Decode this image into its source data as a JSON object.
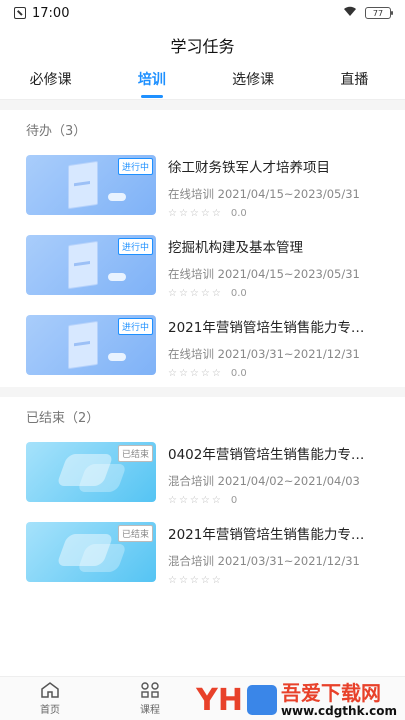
{
  "status": {
    "time": "17:00",
    "battery": "77"
  },
  "header": {
    "title": "学习任务"
  },
  "tabs": [
    {
      "label": "必修课"
    },
    {
      "label": "培训"
    },
    {
      "label": "选修课"
    },
    {
      "label": "直播"
    }
  ],
  "sections": [
    {
      "title": "待办（3）",
      "items": [
        {
          "name": "徐工财务铁军人才培养项目",
          "meta": "在线培训 2021/04/15~2023/05/31",
          "stars": "☆☆☆☆☆",
          "score": "0.0",
          "tag": "进行中"
        },
        {
          "name": "挖掘机构建及基本管理",
          "meta": "在线培训 2021/04/15~2023/05/31",
          "stars": "☆☆☆☆☆",
          "score": "0.0",
          "tag": "进行中"
        },
        {
          "name": "2021年营销管培生销售能力专…",
          "meta": "在线培训 2021/03/31~2021/12/31",
          "stars": "☆☆☆☆☆",
          "score": "0.0",
          "tag": "进行中"
        }
      ]
    },
    {
      "title": "已结束（2）",
      "items": [
        {
          "name": "0402年营销管培生销售能力专…",
          "meta": "混合培训 2021/04/02~2021/04/03",
          "stars": "☆☆☆☆☆",
          "score": "0",
          "tag": "已结束"
        },
        {
          "name": "2021年营销管培生销售能力专…",
          "meta": "混合培训 2021/03/31~2021/12/31",
          "stars": "☆☆☆☆☆",
          "score": "",
          "tag": "已结束"
        }
      ]
    }
  ],
  "bottom_nav": [
    {
      "label": "首页",
      "icon": "home-icon"
    },
    {
      "label": "课程",
      "icon": "course-icon"
    }
  ],
  "watermark": {
    "main": "吾爱下载网",
    "url": "www.cdgthk.com"
  }
}
